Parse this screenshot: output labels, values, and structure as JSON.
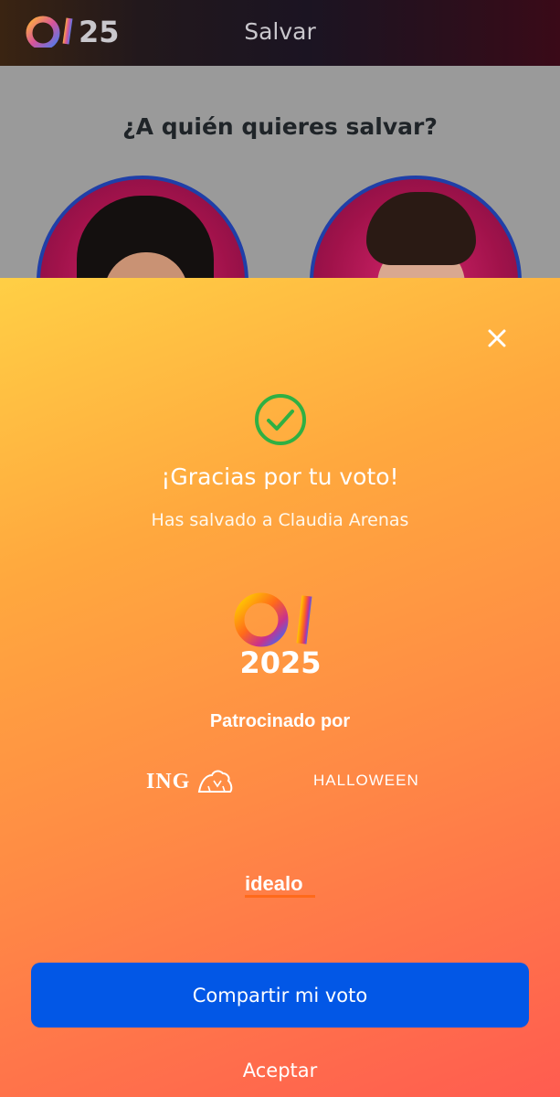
{
  "topbar": {
    "logo_text": "OT25",
    "title": "Salvar"
  },
  "background": {
    "question": "¿A quién quieres salvar?"
  },
  "modal": {
    "thanks": "¡Gracias por tu voto!",
    "saved_text": "Has salvado a Claudia Arenas",
    "logo_text": "OT 2025",
    "sponsored_label": "Patrocinado por",
    "sponsors": {
      "ing": "ING",
      "halloween": "HALLOWEEN",
      "idealo": "idealo"
    },
    "share_button": "Compartir mi voto",
    "accept_link": "Aceptar"
  },
  "colors": {
    "accent_button": "#0257e6",
    "check_green": "#2fb043",
    "contestant_ring": "#1f3fa8"
  },
  "icons": [
    "close-icon",
    "check-circle-icon",
    "ing-lion-icon"
  ]
}
